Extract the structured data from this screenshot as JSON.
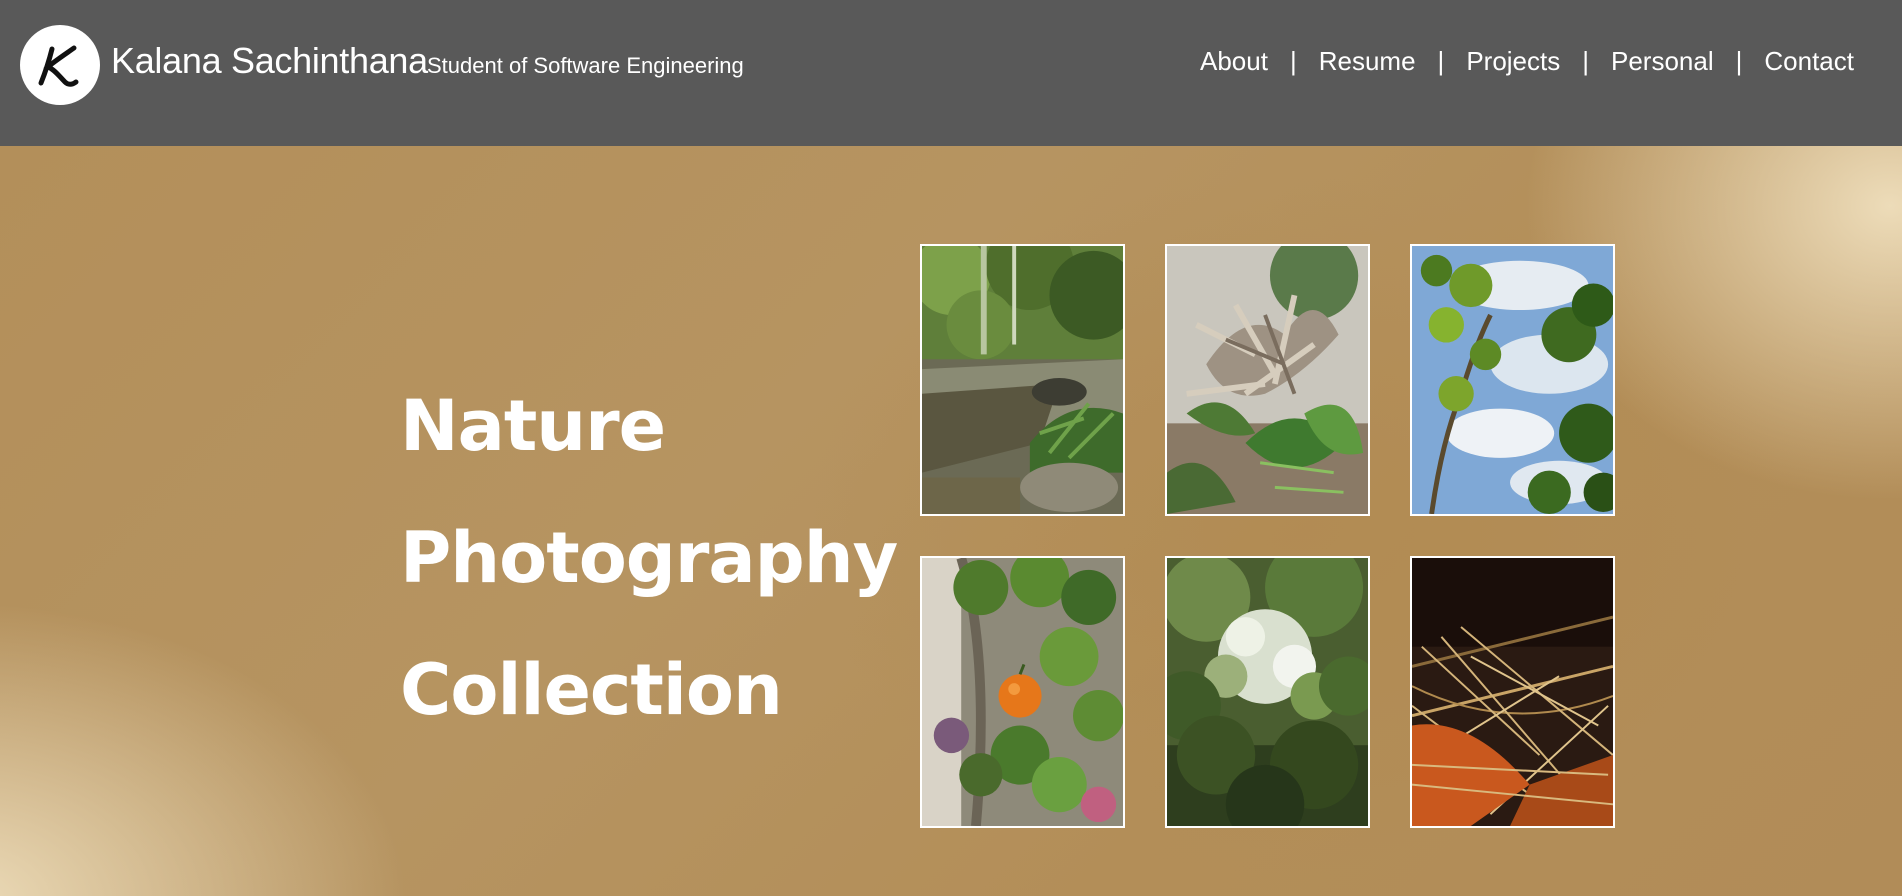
{
  "header": {
    "logo_letter": "K",
    "site_name": "Kalana Sachinthana",
    "tagline": "Student of Software Engineering",
    "bg_color": "#595959",
    "nav": [
      {
        "label": "About"
      },
      {
        "label": "Resume"
      },
      {
        "label": "Projects"
      },
      {
        "label": "Personal"
      },
      {
        "label": "Contact"
      }
    ],
    "nav_separator": "|"
  },
  "hero": {
    "title_lines": [
      "Nature",
      "Photography",
      "Collection"
    ],
    "accent_color": "#b38f5a"
  },
  "gallery": {
    "photos": [
      {
        "icon": "river-stream-photo"
      },
      {
        "icon": "driftwood-plants-photo"
      },
      {
        "icon": "sky-leaves-photo"
      },
      {
        "icon": "orange-fruit-vine-photo"
      },
      {
        "icon": "tree-canopy-photo"
      },
      {
        "icon": "dry-grass-nest-photo"
      }
    ]
  }
}
